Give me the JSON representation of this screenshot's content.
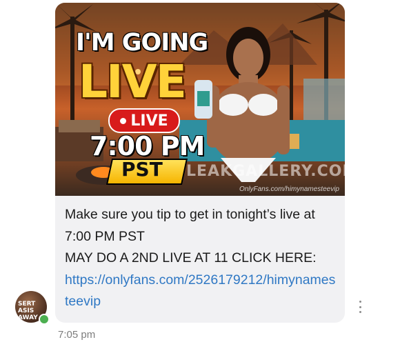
{
  "message": {
    "media": {
      "headline_line1": "I'M GOING",
      "headline_line2": "LIVE",
      "badge_label": "LIVE",
      "time_text": "7:00 PM",
      "timezone_text": "PST",
      "watermark": "LEAKGALLERY.COM",
      "source_caption": "OnlyFans.com/himynamesteevip"
    },
    "text_line1": "Make sure you tip to get in tonight’s live at 7:00 PM PST",
    "text_line2": "MAY DO A 2ND LIVE AT 11 CLICK HERE:",
    "link_url": "https://onlyfans.com/2526179212/himynamesteevip",
    "timestamp": "7:05 pm"
  },
  "sender": {
    "avatar_text": "SERT\nASIS\nAWAY",
    "status": "online"
  },
  "colors": {
    "bubble_bg": "#f1f1f3",
    "link": "#2f78c4",
    "online": "#4caf50",
    "live_red": "#d81b1b",
    "headline_yellow": "#ffd23a"
  },
  "icons": {
    "more": "vertical-ellipsis-icon"
  }
}
